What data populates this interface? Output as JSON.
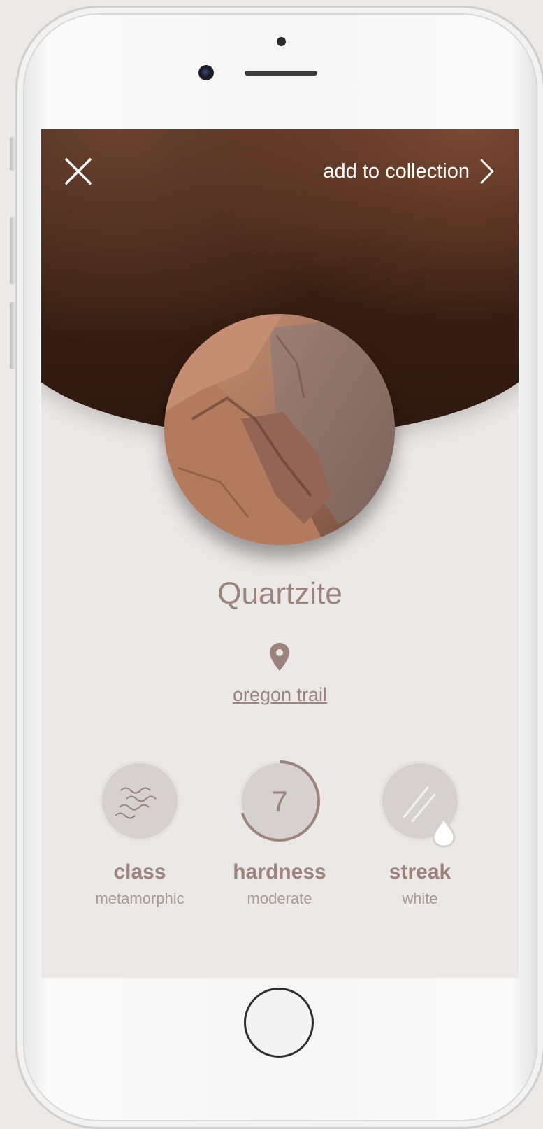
{
  "header": {
    "close_icon": "close-icon",
    "add_to_collection_label": "add to collection",
    "chevron_icon": "chevron-right-icon"
  },
  "rock": {
    "name": "Quartzite",
    "location_icon": "map-pin-icon",
    "location": "oregon trail"
  },
  "stats": [
    {
      "icon": "waves-icon",
      "label": "class",
      "value": "metamorphic"
    },
    {
      "number": "7",
      "label": "hardness",
      "value": "moderate",
      "level": 0.7
    },
    {
      "icon": "streak-drop-icon",
      "label": "streak",
      "value": "white"
    }
  ],
  "colors": {
    "accent": "#9a847b",
    "hero_dark": "#3c2115",
    "background": "#ece8e6"
  }
}
